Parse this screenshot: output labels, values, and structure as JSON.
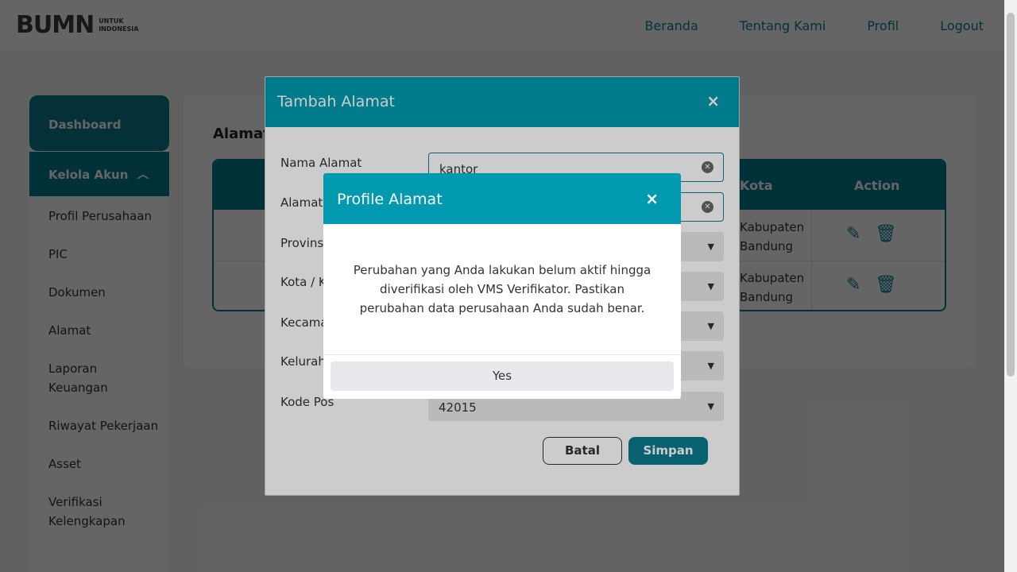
{
  "navbar": {
    "logo_text": "BUMN",
    "logo_sub_1": "UNTUK",
    "logo_sub_2": "INDONESIA",
    "links": [
      "Beranda",
      "Tentang Kami",
      "Profil",
      "Logout"
    ]
  },
  "sidebar": {
    "dashboard": "Dashboard",
    "kelola_akun": "Kelola Akun",
    "items": [
      "Profil Perusahaan",
      "PIC",
      "Dokumen",
      "Alamat",
      "Laporan Keuangan",
      "Riwayat Pekerjaan",
      "Asset",
      "Verifikasi Kelengkapan"
    ]
  },
  "content": {
    "title": "Alamat",
    "table": {
      "headers": [
        "Kota",
        "Action"
      ],
      "rows": [
        {
          "kota": "Kabupaten Bandung"
        },
        {
          "kota": "Kabupaten Bandung"
        }
      ]
    }
  },
  "modal_tambah": {
    "title": "Tambah Alamat",
    "close": "×",
    "fields": [
      {
        "label": "Nama Alamat",
        "value": "kantor"
      },
      {
        "label": "Alamat",
        "value": ""
      },
      {
        "label": "Provinsi",
        "value": ""
      },
      {
        "label": "Kota / Kabupaten",
        "value": ""
      },
      {
        "label": "Kecamatan",
        "value": ""
      },
      {
        "label": "Kelurahan",
        "value": ""
      },
      {
        "label": "Kode Pos",
        "value": "42015"
      }
    ],
    "batal": "Batal",
    "simpan": "Simpan"
  },
  "modal_profile": {
    "title": "Profile Alamat",
    "close": "×",
    "message": "Perubahan yang Anda lakukan belum aktif hingga diverifikasi oleh VMS Verifikator. Pastikan perubahan data perusahaan Anda sudah benar.",
    "yes": "Yes"
  },
  "colors": {
    "primary": "#007d90",
    "accent": "#0099b0"
  }
}
